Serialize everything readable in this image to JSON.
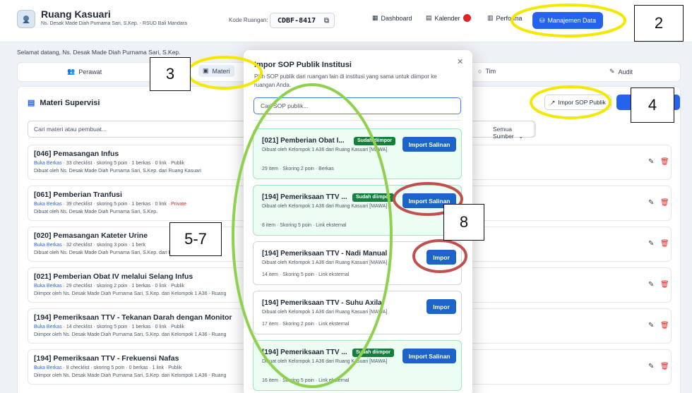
{
  "header": {
    "app_title": "Ruang Kasuari",
    "app_subtitle": "Ns. Desak Made Diah Purnama Sari, S.Kep. - RSUD Bali Mandara",
    "kode_label": "Kode Ruangan:",
    "kode_value": "CDBF-8417",
    "nav": {
      "dashboard": "Dashboard",
      "kalender": "Kalender",
      "performa": "Performa",
      "manajemen": "Manajemen Data"
    }
  },
  "welcome": "Selamat datang, Ns. Desak Made Diah Purnama Sari, S.Kep.",
  "tabs": [
    "Perawat",
    "Materi",
    "Tim",
    "Audit"
  ],
  "panel": {
    "title": "Materi Supervisi",
    "import_button": "Impor SOP Publik",
    "search_placeholder": "Cari materi atau pembuat...",
    "filter_value": "Semua Sumber",
    "rows": [
      {
        "title": "[046] Pemasangan Infus",
        "link": "Buka Berkas",
        "meta": " · 33 checklist · skoring 5 poin · 1 berkas · 0 link · ",
        "visibility": "Publik",
        "by": "Dibuat oleh Ns. Desak Made Diah Purnama Sari, S.Kep. dari Ruang Kasuari"
      },
      {
        "title": "[061] Pemberian Tranfusi",
        "link": "Buka Berkas",
        "meta": " · 39 checklist · skoring 5 poin · 1 berkas · 0 link · ",
        "visibility": "Private",
        "by": "Dibuat oleh Ns. Desak Made Diah Purnama Sari, S.Kep."
      },
      {
        "title": "[020] Pemasangan Kateter Urine",
        "link": "Buka Berkas",
        "meta": " · 32 checklist · skoring 3 poin · 1 berk",
        "visibility": "",
        "by": "Dibuat oleh Ns. Desak Made Diah Purnama Sari, S.Kep. dari Ruang Kasuari"
      },
      {
        "title": "[021] Pemberian Obat IV melalui Selang Infus",
        "link": "Buka Berkas",
        "meta": " · 29 checklist · skoring 2 poin · 1 berkas · 0 link · ",
        "visibility": "Publik",
        "by": "Diimpor oleh Ns. Desak Made Diah Purnama Sari, S.Kep. dari Kelompok 1 A36 - Ruang"
      },
      {
        "title": "[194] Pemeriksaan TTV - Tekanan Darah dengan Monitor",
        "link": "Buka Berkas",
        "meta": " · 14 checklist · skoring 5 poin · 1 berkas · 0 link · ",
        "visibility": "Publik",
        "by": "Diimpor oleh Ns. Desak Made Diah Purnama Sari, S.Kep. dari Kelompok 1 A36 - Ruang"
      },
      {
        "title": "[194] Pemeriksaan TTV - Frekuensi Nafas",
        "link": "Buka Berkas",
        "meta": " · 8 checklist · skoring 5 poin · 0 berkas · 1 link · ",
        "visibility": "Publik",
        "by": "Diimpor oleh Ns. Desak Made Diah Purnama Sari, S.Kep. dari Kelompok 1 A36 - Ruang"
      }
    ]
  },
  "modal": {
    "title": "Impor SOP Publik Institusi",
    "description": "Pilih SOP publik dari ruangan lain di institusi yang sama untuk diimpor ke ruangan Anda.",
    "search_placeholder": "Cari SOP publik...",
    "cards": [
      {
        "title": "[021] Pemberian Obat I...",
        "badge": "Sudah diimpor",
        "from": "Dibuat oleh Kelompok 1 A36 dari Ruang Kasuari [MAWA]",
        "stats": "29 item · Skoring 2 poin · Berkas",
        "button": "Import Salinan"
      },
      {
        "title": "[194] Pemeriksaan TTV ...",
        "badge": "Sudah diimpor",
        "from": "Dibuat oleh Kelompok 1 A36 dari Ruang Kasuari [MAWA]",
        "stats": "8 item · Skoring 5 poin · Link eksternal",
        "button": "Import Salinan"
      },
      {
        "title": "[194] Pemeriksaan TTV - Nadi Manual",
        "badge": "",
        "from": "Dibuat oleh Kelompok 1 A36 dari Ruang Kasuari [MAWA]",
        "stats": "14 item · Skoring 5 poin · Link eksternal",
        "button": "Impor"
      },
      {
        "title": "[194] Pemeriksaan TTV - Suhu Axila",
        "badge": "",
        "from": "Dibuat oleh Kelompok 1 A36 dari Ruang Kasuari [MAWA]",
        "stats": "17 item · Skoring 2 poin · Link eksternal",
        "button": "Impor"
      },
      {
        "title": "[194] Pemeriksaan TTV ...",
        "badge": "Sudah diimpor",
        "from": "Dibuat oleh Kelompok 1 A36 dari Ruang Kasuari [MAWA]",
        "stats": "16 item · Skoring 5 poin · Link eksternal",
        "button": "Import Salinan"
      }
    ]
  },
  "annotations": {
    "label_2": "2",
    "label_3": "3",
    "label_4": "4",
    "label_5_7": "5-7",
    "label_8": "8"
  },
  "colors": {
    "primary": "#2563eb",
    "imported_badge": "#15803d",
    "highlight_yellow": "#f5e800",
    "highlight_green": "#8fd14f",
    "highlight_red": "#c0504d"
  }
}
